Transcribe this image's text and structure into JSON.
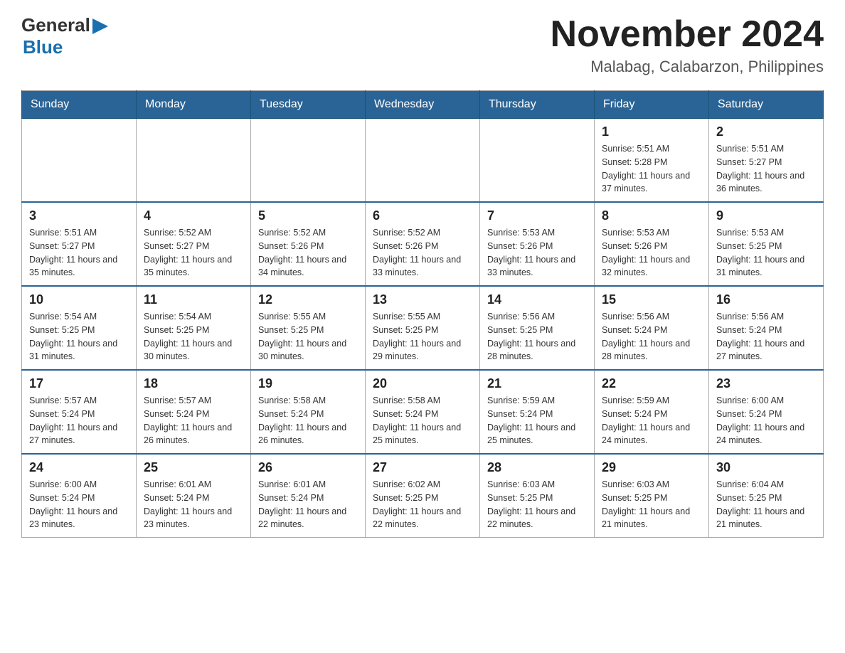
{
  "header": {
    "logo": {
      "general": "General",
      "blue": "Blue",
      "triangle": "▶"
    },
    "month_title": "November 2024",
    "location": "Malabag, Calabarzon, Philippines"
  },
  "calendar": {
    "days_of_week": [
      "Sunday",
      "Monday",
      "Tuesday",
      "Wednesday",
      "Thursday",
      "Friday",
      "Saturday"
    ],
    "weeks": [
      [
        {
          "day": "",
          "info": ""
        },
        {
          "day": "",
          "info": ""
        },
        {
          "day": "",
          "info": ""
        },
        {
          "day": "",
          "info": ""
        },
        {
          "day": "",
          "info": ""
        },
        {
          "day": "1",
          "info": "Sunrise: 5:51 AM\nSunset: 5:28 PM\nDaylight: 11 hours and 37 minutes."
        },
        {
          "day": "2",
          "info": "Sunrise: 5:51 AM\nSunset: 5:27 PM\nDaylight: 11 hours and 36 minutes."
        }
      ],
      [
        {
          "day": "3",
          "info": "Sunrise: 5:51 AM\nSunset: 5:27 PM\nDaylight: 11 hours and 35 minutes."
        },
        {
          "day": "4",
          "info": "Sunrise: 5:52 AM\nSunset: 5:27 PM\nDaylight: 11 hours and 35 minutes."
        },
        {
          "day": "5",
          "info": "Sunrise: 5:52 AM\nSunset: 5:26 PM\nDaylight: 11 hours and 34 minutes."
        },
        {
          "day": "6",
          "info": "Sunrise: 5:52 AM\nSunset: 5:26 PM\nDaylight: 11 hours and 33 minutes."
        },
        {
          "day": "7",
          "info": "Sunrise: 5:53 AM\nSunset: 5:26 PM\nDaylight: 11 hours and 33 minutes."
        },
        {
          "day": "8",
          "info": "Sunrise: 5:53 AM\nSunset: 5:26 PM\nDaylight: 11 hours and 32 minutes."
        },
        {
          "day": "9",
          "info": "Sunrise: 5:53 AM\nSunset: 5:25 PM\nDaylight: 11 hours and 31 minutes."
        }
      ],
      [
        {
          "day": "10",
          "info": "Sunrise: 5:54 AM\nSunset: 5:25 PM\nDaylight: 11 hours and 31 minutes."
        },
        {
          "day": "11",
          "info": "Sunrise: 5:54 AM\nSunset: 5:25 PM\nDaylight: 11 hours and 30 minutes."
        },
        {
          "day": "12",
          "info": "Sunrise: 5:55 AM\nSunset: 5:25 PM\nDaylight: 11 hours and 30 minutes."
        },
        {
          "day": "13",
          "info": "Sunrise: 5:55 AM\nSunset: 5:25 PM\nDaylight: 11 hours and 29 minutes."
        },
        {
          "day": "14",
          "info": "Sunrise: 5:56 AM\nSunset: 5:25 PM\nDaylight: 11 hours and 28 minutes."
        },
        {
          "day": "15",
          "info": "Sunrise: 5:56 AM\nSunset: 5:24 PM\nDaylight: 11 hours and 28 minutes."
        },
        {
          "day": "16",
          "info": "Sunrise: 5:56 AM\nSunset: 5:24 PM\nDaylight: 11 hours and 27 minutes."
        }
      ],
      [
        {
          "day": "17",
          "info": "Sunrise: 5:57 AM\nSunset: 5:24 PM\nDaylight: 11 hours and 27 minutes."
        },
        {
          "day": "18",
          "info": "Sunrise: 5:57 AM\nSunset: 5:24 PM\nDaylight: 11 hours and 26 minutes."
        },
        {
          "day": "19",
          "info": "Sunrise: 5:58 AM\nSunset: 5:24 PM\nDaylight: 11 hours and 26 minutes."
        },
        {
          "day": "20",
          "info": "Sunrise: 5:58 AM\nSunset: 5:24 PM\nDaylight: 11 hours and 25 minutes."
        },
        {
          "day": "21",
          "info": "Sunrise: 5:59 AM\nSunset: 5:24 PM\nDaylight: 11 hours and 25 minutes."
        },
        {
          "day": "22",
          "info": "Sunrise: 5:59 AM\nSunset: 5:24 PM\nDaylight: 11 hours and 24 minutes."
        },
        {
          "day": "23",
          "info": "Sunrise: 6:00 AM\nSunset: 5:24 PM\nDaylight: 11 hours and 24 minutes."
        }
      ],
      [
        {
          "day": "24",
          "info": "Sunrise: 6:00 AM\nSunset: 5:24 PM\nDaylight: 11 hours and 23 minutes."
        },
        {
          "day": "25",
          "info": "Sunrise: 6:01 AM\nSunset: 5:24 PM\nDaylight: 11 hours and 23 minutes."
        },
        {
          "day": "26",
          "info": "Sunrise: 6:01 AM\nSunset: 5:24 PM\nDaylight: 11 hours and 22 minutes."
        },
        {
          "day": "27",
          "info": "Sunrise: 6:02 AM\nSunset: 5:25 PM\nDaylight: 11 hours and 22 minutes."
        },
        {
          "day": "28",
          "info": "Sunrise: 6:03 AM\nSunset: 5:25 PM\nDaylight: 11 hours and 22 minutes."
        },
        {
          "day": "29",
          "info": "Sunrise: 6:03 AM\nSunset: 5:25 PM\nDaylight: 11 hours and 21 minutes."
        },
        {
          "day": "30",
          "info": "Sunrise: 6:04 AM\nSunset: 5:25 PM\nDaylight: 11 hours and 21 minutes."
        }
      ]
    ]
  }
}
